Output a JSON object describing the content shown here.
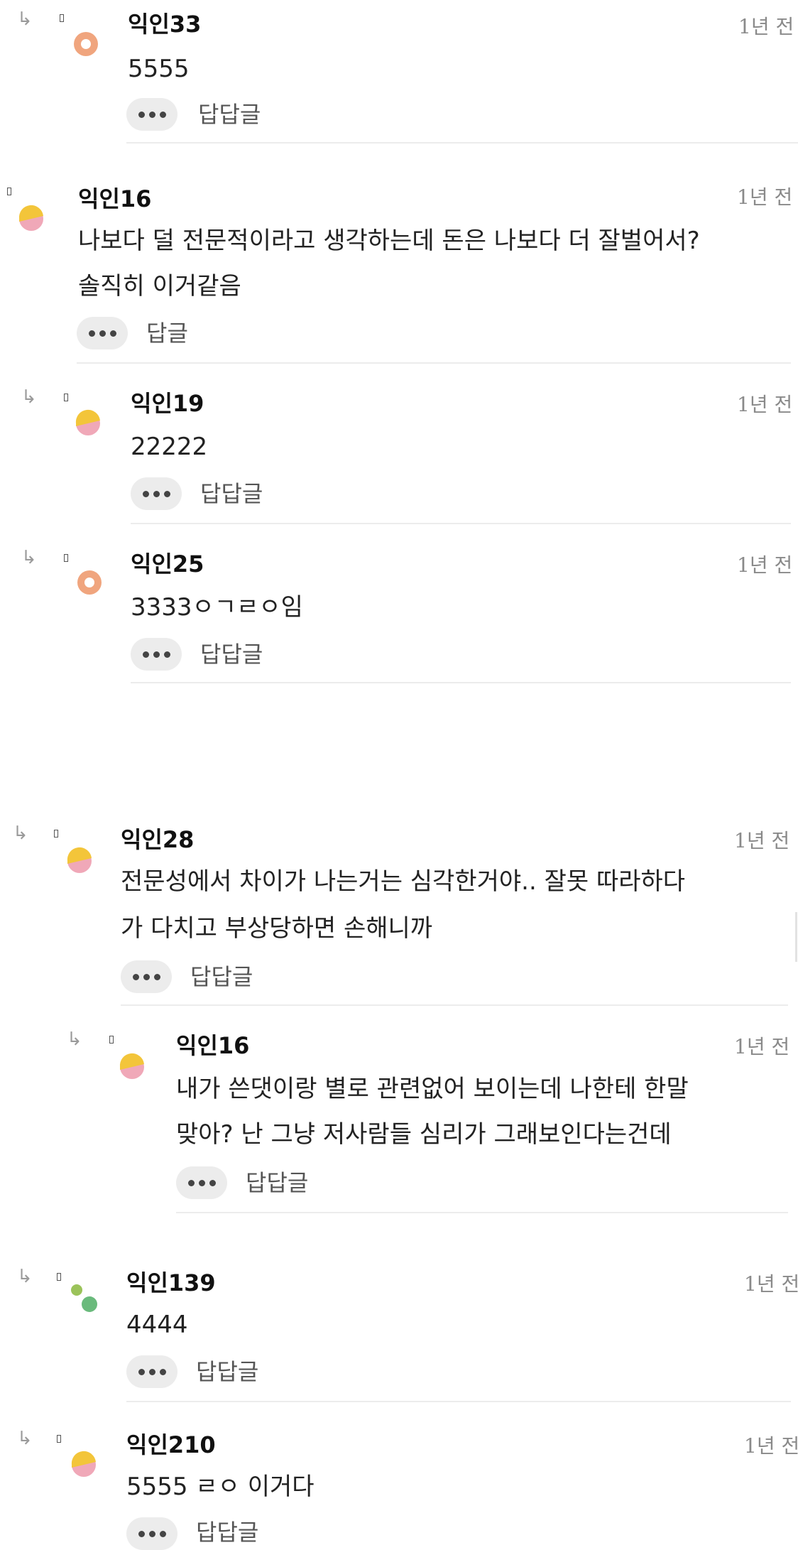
{
  "comments": [
    {
      "name": "익인33",
      "time": "1년 전",
      "lines": [
        "5555"
      ],
      "action": "답답글",
      "avatar": "ring-orange-avatar"
    },
    {
      "name": "익인16",
      "time": "1년 전",
      "lines": [
        "나보다 덜 전문적이라고 생각하는데 돈은 나보다 더 잘벌어서?",
        "솔직히 이거같음"
      ],
      "action": "답글",
      "avatar": "half-moon-yellow-pink-avatar"
    },
    {
      "name": "익인19",
      "time": "1년 전",
      "lines": [
        "22222"
      ],
      "action": "답답글",
      "avatar": "half-moon-yellow-pink-avatar"
    },
    {
      "name": "익인25",
      "time": "1년 전",
      "lines": [
        "3333ㅇㄱㄹㅇ임"
      ],
      "action": "답답글",
      "avatar": "ring-orange-avatar"
    },
    {
      "name": "익인28",
      "time": "1년 전",
      "lines": [
        "전문성에서 차이가 나는거는 심각한거야.. 잘못 따라하다",
        "가 다치고 부상당하면 손해니까"
      ],
      "action": "답답글",
      "avatar": "half-moon-yellow-pink-avatar"
    },
    {
      "name": "익인16",
      "time": "1년 전",
      "lines": [
        "내가 쓴댓이랑 별로 관련없어 보이는데 나한테 한말",
        "맞아? 난 그냥 저사람들 심리가 그래보인다는건데"
      ],
      "action": "답답글",
      "avatar": "half-moon-yellow-pink-avatar"
    },
    {
      "name": "익인139",
      "time": "1년 전",
      "lines": [
        "4444"
      ],
      "action": "답답글",
      "avatar": "green-dots-avatar"
    },
    {
      "name": "익인210",
      "time": "1년 전",
      "lines": [
        "5555 ㄹㅇ 이거다"
      ],
      "action": "답답글",
      "avatar": "half-moon-yellow-pink-avatar"
    }
  ],
  "icons": {
    "reply_arrow": "reply-arrow-icon",
    "more": "more-dots-icon"
  },
  "colors": {
    "ring_orange": "#f0a57e",
    "moon_yellow": "#f3c53a",
    "moon_pink": "#f0a8b8",
    "dot_green_light": "#9bc35a",
    "dot_green": "#6aba7c"
  }
}
